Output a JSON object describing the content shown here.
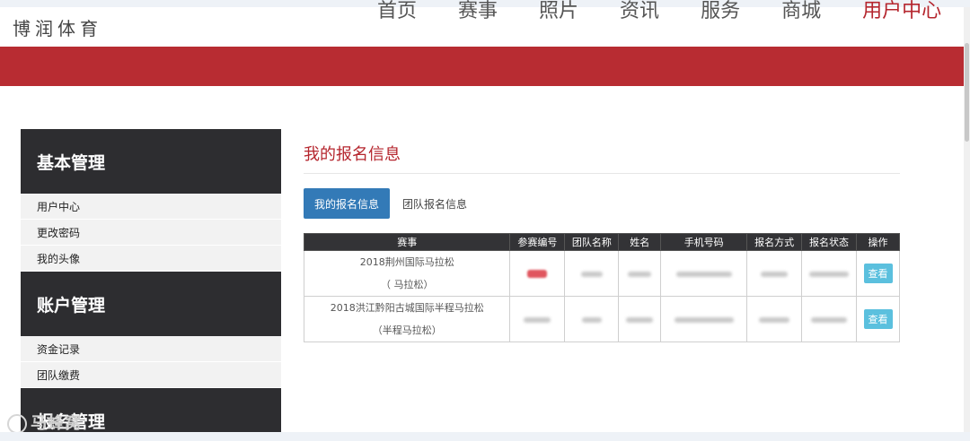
{
  "header": {
    "logo": "博润体育",
    "nav": [
      {
        "label": "首页",
        "active": false
      },
      {
        "label": "赛事",
        "active": false
      },
      {
        "label": "照片",
        "active": false
      },
      {
        "label": "资讯",
        "active": false
      },
      {
        "label": "服务",
        "active": false
      },
      {
        "label": "商城",
        "active": false
      },
      {
        "label": "用户中心",
        "active": true
      }
    ]
  },
  "colors": {
    "brand_red": "#b82c32",
    "tab_blue": "#337ab7",
    "view_button": "#5bc0de",
    "sidebar_dark": "#2d2d30"
  },
  "sidebar": {
    "groups": [
      {
        "title": "基本管理",
        "items": [
          "用户中心",
          "更改密码",
          "我的头像"
        ]
      },
      {
        "title": "账户管理",
        "items": [
          "资金记录",
          "团队缴费"
        ]
      },
      {
        "title": "报名管理",
        "items": []
      }
    ]
  },
  "main": {
    "title": "我的报名信息",
    "tabs": [
      {
        "label": "我的报名信息",
        "active": true
      },
      {
        "label": "团队报名信息",
        "active": false
      }
    ],
    "table": {
      "columns": [
        "赛事",
        "参赛编号",
        "团队名称",
        "姓名",
        "手机号码",
        "报名方式",
        "报名状态",
        "操作"
      ],
      "rows": [
        {
          "event_line1": "2018荆州国际马拉松",
          "event_line2": "（  马拉松）",
          "action": "查看"
        },
        {
          "event_line1": "2018洪江黔阳古城国际半程马拉松",
          "event_line2": "（半程马拉松）",
          "action": "查看"
        }
      ]
    }
  },
  "watermark": "马蜂窝"
}
